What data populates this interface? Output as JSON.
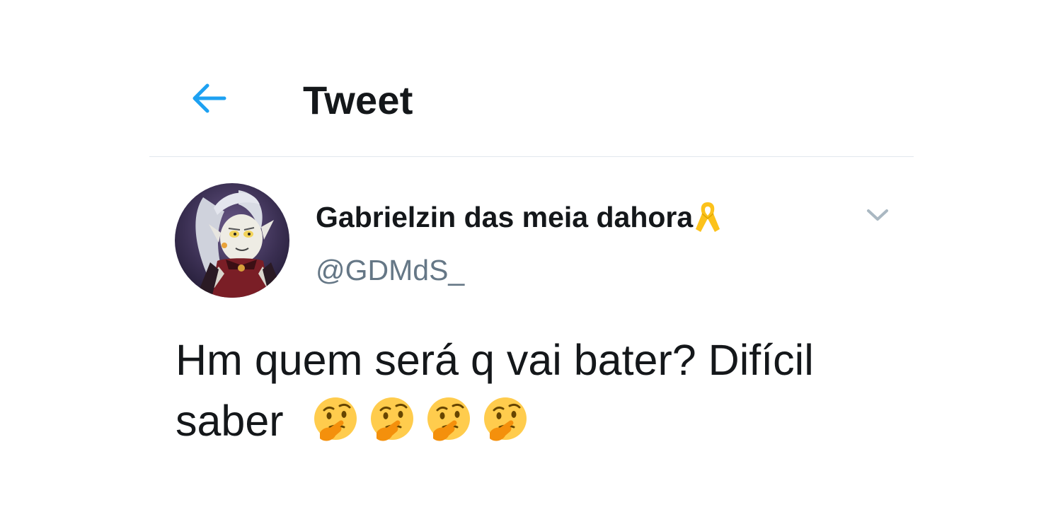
{
  "header": {
    "back_icon": "arrow-left-icon",
    "title": "Tweet"
  },
  "tweet": {
    "author": {
      "display_name": "Gabrielzin das meia dahora",
      "badge_icon": "yellow-ribbon-icon",
      "username": "@GDMdS_"
    },
    "menu_icon": "chevron-down-icon",
    "text_line_1": "Hm quem será q vai bater? Difícil",
    "text_line_2": "saber",
    "emojis": [
      "thinking-face-icon",
      "thinking-face-icon",
      "thinking-face-icon",
      "thinking-face-icon"
    ]
  },
  "colors": {
    "accent": "#1da1f2",
    "text_primary": "#14171a",
    "text_secondary": "#657786",
    "divider": "#e1e8ed",
    "chevron": "#aab8c2",
    "ribbon": "#fcc21b"
  }
}
